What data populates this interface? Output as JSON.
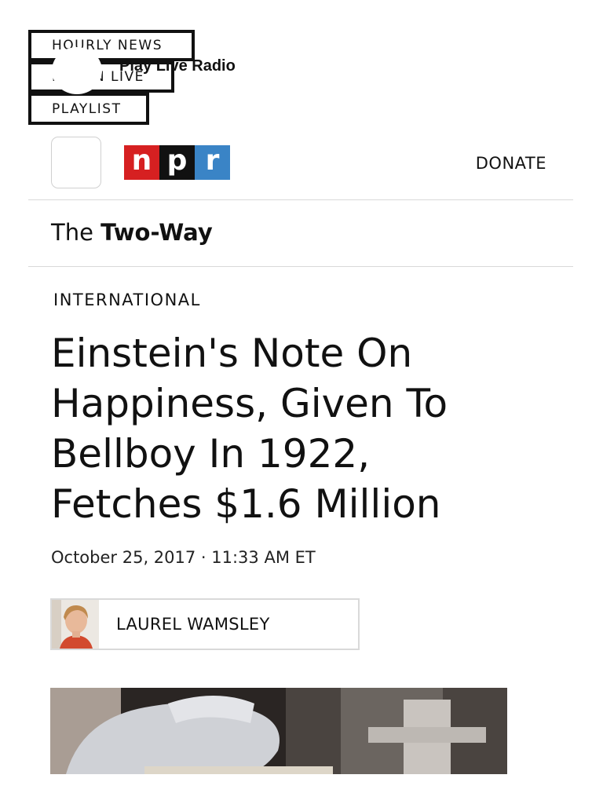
{
  "skip_links": {
    "hourly_news": "HOURLY NEWS",
    "listen_live": "LISTEN LIVE",
    "playlist": "PLAYLIST"
  },
  "player": {
    "label": "Play Live Radio"
  },
  "header": {
    "logo_letters": [
      "n",
      "p",
      "r"
    ],
    "donate": "DONATE"
  },
  "section": {
    "prefix": "The",
    "name": "Two-Way"
  },
  "article": {
    "category": "INTERNATIONAL",
    "title": "Einstein's Note On Happiness, Given To Bellboy In 1922, Fetches $1.6 Million",
    "date": "October 25, 2017 · 11:33 AM ET",
    "author": "LAUREL WAMSLEY"
  },
  "colors": {
    "npr_red": "#d62021",
    "npr_black": "#111111",
    "npr_blue": "#3a84c6"
  }
}
